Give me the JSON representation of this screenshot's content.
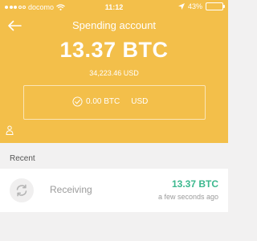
{
  "status_bar": {
    "carrier": "docomo",
    "time": "11:12",
    "battery_percent": "43%",
    "battery_level": 0.43
  },
  "account": {
    "title": "Spending account",
    "balance": "13.37 BTC",
    "balance_fiat": "34,223.46 USD",
    "pending_amount": "0.00 BTC",
    "pending_currency": "USD"
  },
  "recent": {
    "label": "Recent",
    "transactions": [
      {
        "label": "Receiving",
        "amount": "13.37 BTC",
        "time": "a few seconds ago"
      }
    ]
  },
  "colors": {
    "header": "#f3bf4a",
    "incoming": "#3cb88e"
  }
}
